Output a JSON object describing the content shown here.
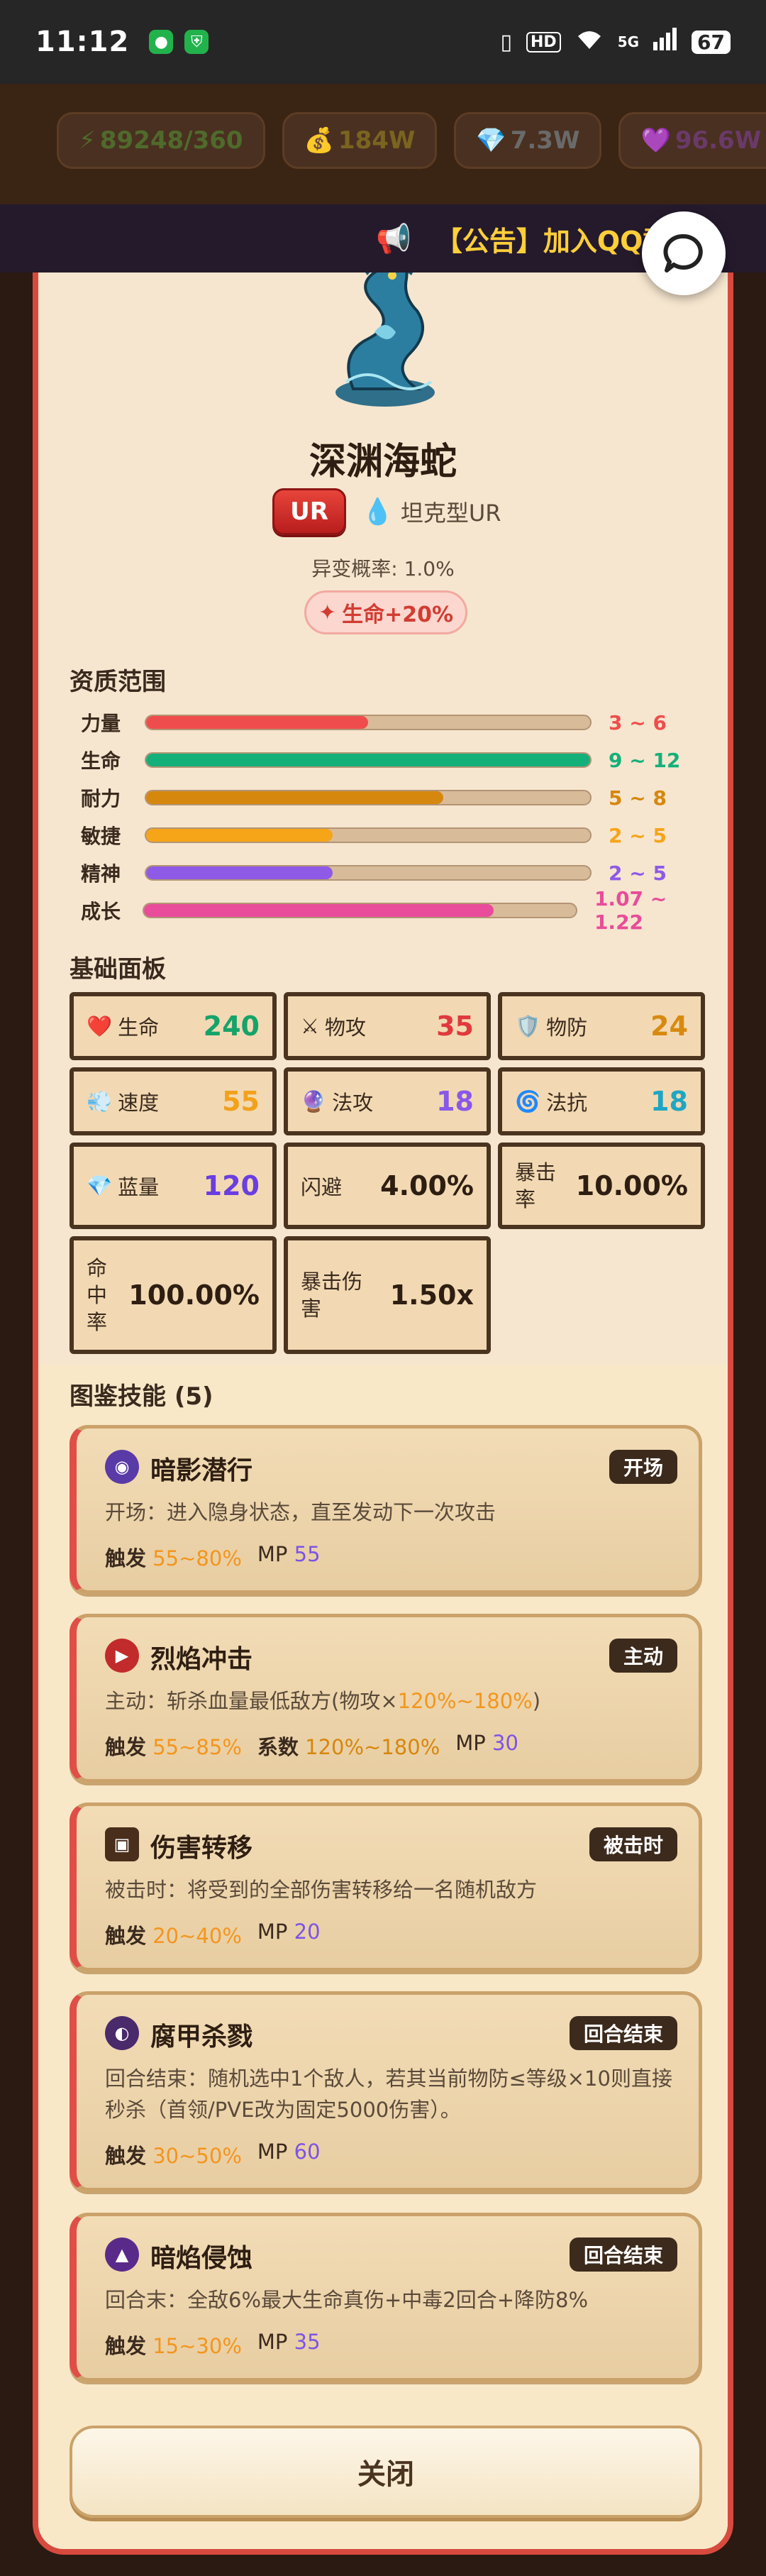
{
  "status_bar": {
    "time": "11:12",
    "signal": "5G",
    "battery": "67",
    "hd": "HD"
  },
  "resources": {
    "energy": "89248/360",
    "gold": "184W",
    "gem": "7.3W",
    "heart": "96.6W"
  },
  "marquee": {
    "text": "【公告】加入QQ群："
  },
  "monster": {
    "name": "深渊海蛇",
    "rarity": "UR",
    "type": "坦克型UR",
    "mutation_rate": "异变概率: 1.0%",
    "bonus": "生命+20%"
  },
  "aptitude": {
    "title": "资质范围",
    "rows": [
      {
        "label": "力量",
        "range": "3 ~ 6",
        "fill": 0.5,
        "color": "#ef4d4d"
      },
      {
        "label": "生命",
        "range": "9 ~ 12",
        "fill": 1.0,
        "color": "#14b07a"
      },
      {
        "label": "耐力",
        "range": "5 ~ 8",
        "fill": 0.67,
        "color": "#d6870d"
      },
      {
        "label": "敏捷",
        "range": "2 ~ 5",
        "fill": 0.42,
        "color": "#f6a418"
      },
      {
        "label": "精神",
        "range": "2 ~ 5",
        "fill": 0.42,
        "color": "#8e5ae6"
      },
      {
        "label": "成长",
        "range": "1.07 ~ 1.22",
        "fill": 0.81,
        "color": "#e84c9a"
      }
    ]
  },
  "panel": {
    "title": "基础面板",
    "hp": {
      "label": "生命",
      "value": "240",
      "color": "#16a36a"
    },
    "patk": {
      "label": "物攻",
      "value": "35",
      "color": "#e0393e"
    },
    "pdef": {
      "label": "物防",
      "value": "24",
      "color": "#d88a10"
    },
    "spd": {
      "label": "速度",
      "value": "55",
      "color": "#f2a11c"
    },
    "matk": {
      "label": "法攻",
      "value": "18",
      "color": "#8a58e8"
    },
    "mdef": {
      "label": "法抗",
      "value": "18",
      "color": "#1fa6c4"
    },
    "mp": {
      "label": "蓝量",
      "value": "120",
      "color": "#6a3ee0"
    },
    "dodge": {
      "label": "闪避",
      "value": "4.00%"
    },
    "crit": {
      "label": "暴击率",
      "value": "10.00%"
    },
    "hit": {
      "label": "命中率",
      "value": "100.00%"
    },
    "critdmg": {
      "label": "暴击伤害",
      "value": "1.50x"
    }
  },
  "skills_title": "图鉴技能 (5)",
  "skills": [
    {
      "name": "暗影潜行",
      "tag": "开场",
      "desc": "开场：进入隐身状态，直至发动下一次攻击",
      "trigger_label": "触发",
      "trigger": "55~80%",
      "mp_label": "MP",
      "mp": "55",
      "icon_color": "#5a3aa6"
    },
    {
      "name": "烈焰冲击",
      "tag": "主动",
      "desc_a": "主动：斩杀血量最低敌方(物攻×",
      "desc_b": "120%~180%",
      "desc_c": ")",
      "trigger_label": "触发",
      "trigger": "55~85%",
      "coef_label": "系数",
      "coef": "120%~180%",
      "mp_label": "MP",
      "mp": "30",
      "icon_color": "#c22b2b"
    },
    {
      "name": "伤害转移",
      "tag": "被击时",
      "desc": "被击时：将受到的全部伤害转移给一名随机敌方",
      "trigger_label": "触发",
      "trigger": "20~40%",
      "mp_label": "MP",
      "mp": "20",
      "icon_color": "#4a2e1c"
    },
    {
      "name": "腐甲杀戮",
      "tag": "回合结束",
      "desc": "回合结束：随机选中1个敌人，若其当前物防≤等级×10则直接秒杀（首领/PVE改为固定5000伤害）。",
      "trigger_label": "触发",
      "trigger": "30~50%",
      "mp_label": "MP",
      "mp": "60",
      "icon_color": "#4a2a6a"
    },
    {
      "name": "暗焰侵蚀",
      "tag": "回合结束",
      "desc": "回合末：全敌6%最大生命真伤+中毒2回合+降防8%",
      "trigger_label": "触发",
      "trigger": "15~30%",
      "mp_label": "MP",
      "mp": "35",
      "icon_color": "#5a2a8a"
    }
  ],
  "close_label": "关闭",
  "icons": {
    "energy": "lightning-icon",
    "gold": "money-bag-icon",
    "gem": "gem-icon",
    "heart": "heart-icon",
    "announce": "megaphone-icon",
    "chat": "chat-bubble-icon"
  }
}
